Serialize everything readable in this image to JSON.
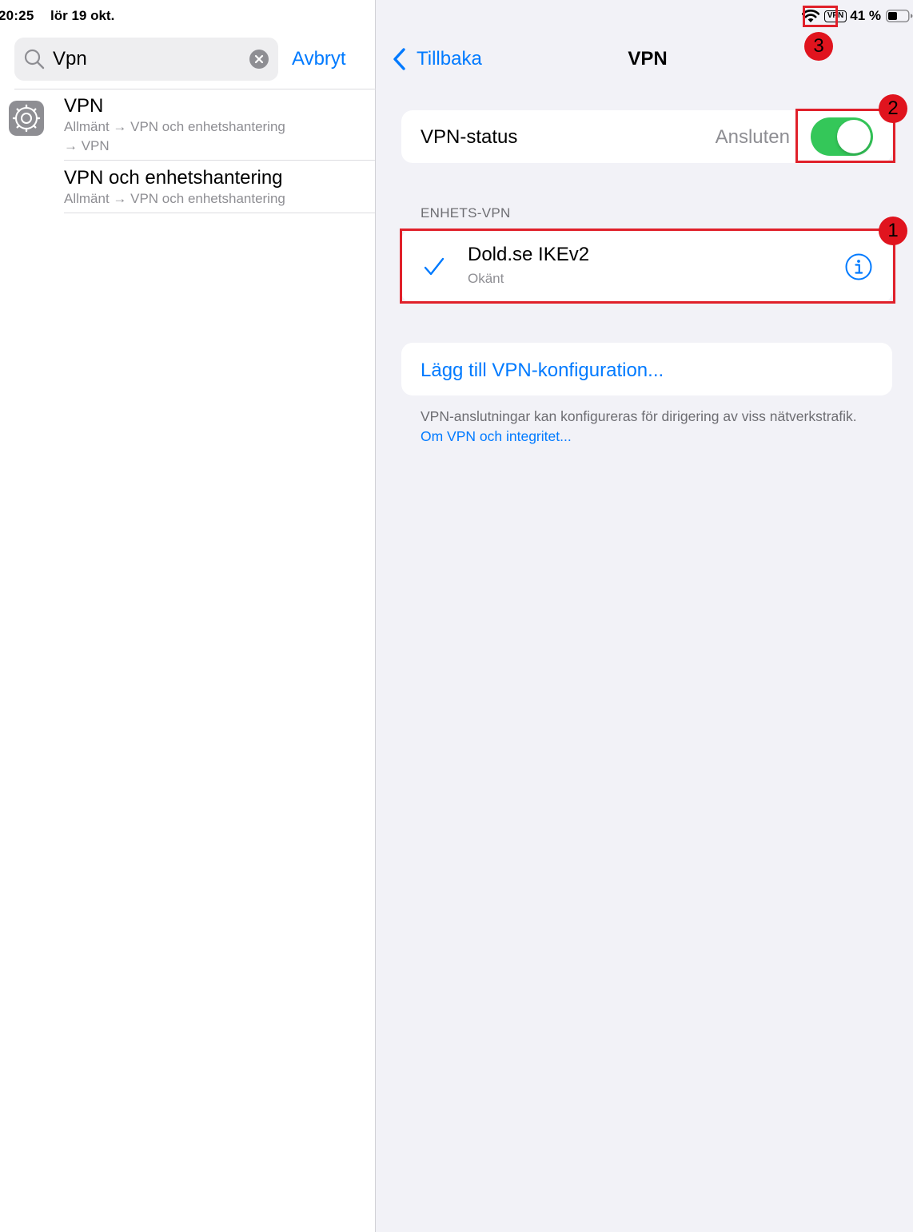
{
  "status_bar": {
    "time": "20:25",
    "date": "lör 19 okt.",
    "vpn_badge": "VPN",
    "battery": "41 %",
    "icons": [
      "wifi-icon",
      "battery-icon"
    ]
  },
  "sidebar": {
    "search": {
      "value": "Vpn",
      "cancel_label": "Avbryt"
    },
    "results": [
      {
        "title": "VPN",
        "path_line1": "Allmänt → VPN och enhetshantering",
        "path_line2": "→ VPN",
        "icon": "settings-gear-icon"
      },
      {
        "title": "VPN och enhetshantering",
        "path_line1": "Allmänt → VPN och enhetshantering"
      }
    ]
  },
  "detail": {
    "back_label": "Tillbaka",
    "title": "VPN",
    "vpn_status": {
      "label": "VPN-status",
      "value": "Ansluten",
      "toggle_on": true
    },
    "section_header": "ENHETS-VPN",
    "config": {
      "name": "Dold.se IKEv2",
      "status": "Okänt",
      "selected": true
    },
    "add_config_label": "Lägg till VPN-konfiguration...",
    "footer_text": "VPN-anslutningar kan konfigureras för dirigering av viss nätverkstrafik.",
    "footer_link": "Om VPN och integritet..."
  },
  "annotations": [
    "1",
    "2",
    "3"
  ],
  "colors": {
    "accent": "#007aff",
    "toggle_on": "#34c759",
    "annotation": "#e0141e",
    "background": "#f2f2f7"
  }
}
